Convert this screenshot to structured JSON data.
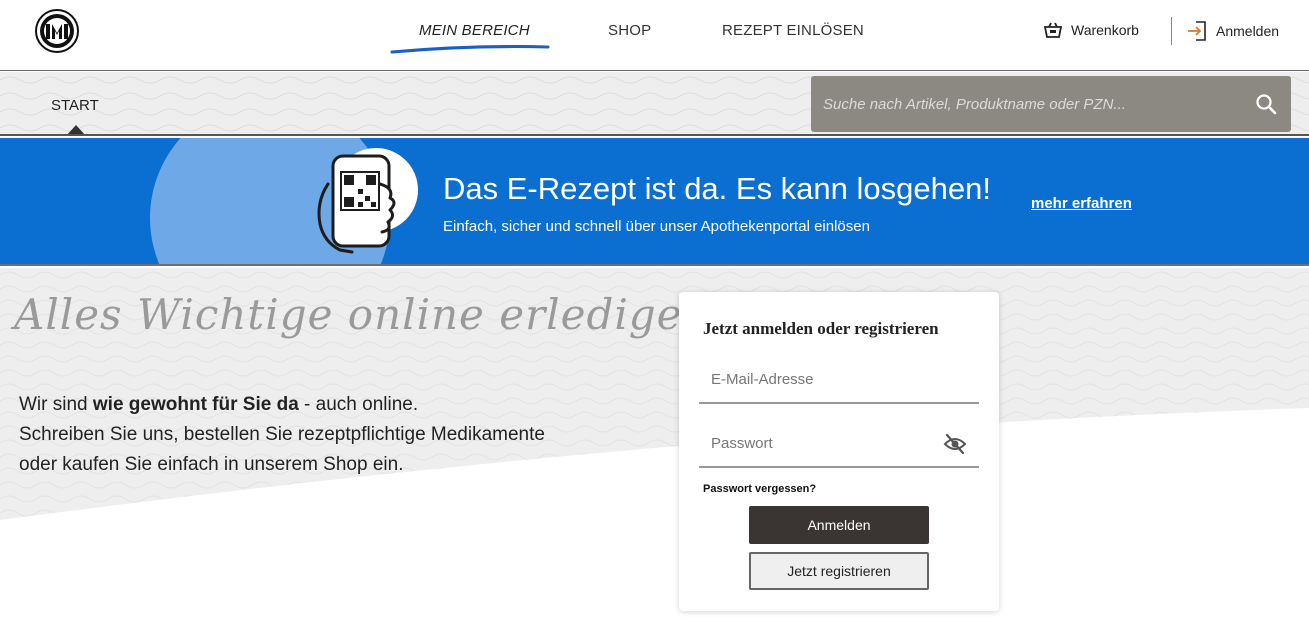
{
  "header": {
    "logo_icon": "pharmacy-seal-logo",
    "nav": [
      {
        "label": "MEIN BEREICH",
        "active": true
      },
      {
        "label": "SHOP",
        "active": false
      },
      {
        "label": "REZEPT EINLÖSEN",
        "active": false
      }
    ],
    "cart_label": "Warenkorb",
    "cart_icon": "basket-icon",
    "login_label": "Anmelden",
    "login_icon": "sign-in-icon",
    "accent_color": "#1a5fc4"
  },
  "subnav": {
    "tab_label": "START",
    "search_placeholder": "Suche nach Artikel, Produktname oder PZN...",
    "search_icon": "search-icon"
  },
  "banner": {
    "title": "Das E-Rezept ist da. Es kann losgehen!",
    "subtitle": "Einfach, sicher und schnell über unser Apothekenportal einlösen",
    "link_label": "mehr erfahren",
    "background_color": "#0a6fd1",
    "illustration_icon": "phone-qr-code-icon"
  },
  "main": {
    "headline": "Alles Wichtige online erledigen!",
    "intro_line1_pre": "Wir sind ",
    "intro_line1_bold": "wie gewohnt für Sie da",
    "intro_line1_post": " - auch online.",
    "intro_line2": "Schreiben Sie uns, bestellen Sie rezeptpflichtige Medikamente",
    "intro_line3": "oder kaufen Sie einfach in unserem Shop ein."
  },
  "login": {
    "title": "Jetzt anmelden oder registrieren",
    "email_placeholder": "E-Mail-Adresse",
    "password_placeholder": "Passwort",
    "password_toggle_icon": "eye-off-icon",
    "forgot_label": "Passwort vergessen?",
    "login_button": "Anmelden",
    "register_button": "Jetzt registrieren"
  }
}
